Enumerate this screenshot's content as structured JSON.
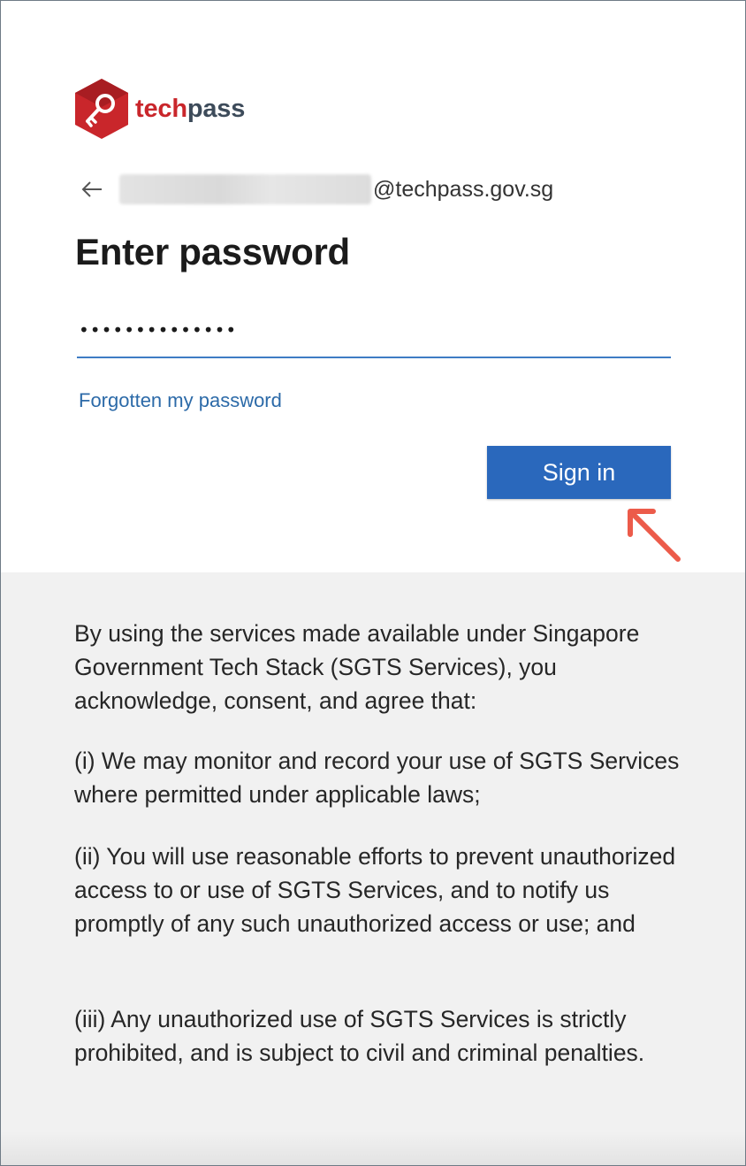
{
  "brand": {
    "name_part1": "tech",
    "name_part2": "pass",
    "logo_icon": "key-hexagon-icon",
    "color_primary": "#c9262b",
    "color_secondary": "#3d4b5a"
  },
  "identity": {
    "back_icon": "back-arrow-icon",
    "email_domain": "@techpass.gov.sg"
  },
  "login": {
    "title": "Enter password",
    "password_value": "••••••••••••••",
    "forgot_link": "Forgotten my password",
    "signin_label": "Sign in",
    "accent_color": "#2a68bc"
  },
  "annotation": {
    "icon": "pointer-arrow-icon",
    "color": "#ec5b4a"
  },
  "notice": {
    "intro": "By using the services made available under Singapore Government Tech Stack (SGTS Services), you acknowledge, consent, and agree that:",
    "item1": "(i) We may monitor and record your use of SGTS Services where permitted under applicable laws;",
    "item2": "(ii) You will use reasonable efforts to prevent unauthorized access to or use of SGTS Services, and to notify us promptly of any such unauthorized access or use; and",
    "item3": "(iii) Any unauthorized use of SGTS Services is strictly prohibited, and is subject to civil and criminal penalties."
  }
}
